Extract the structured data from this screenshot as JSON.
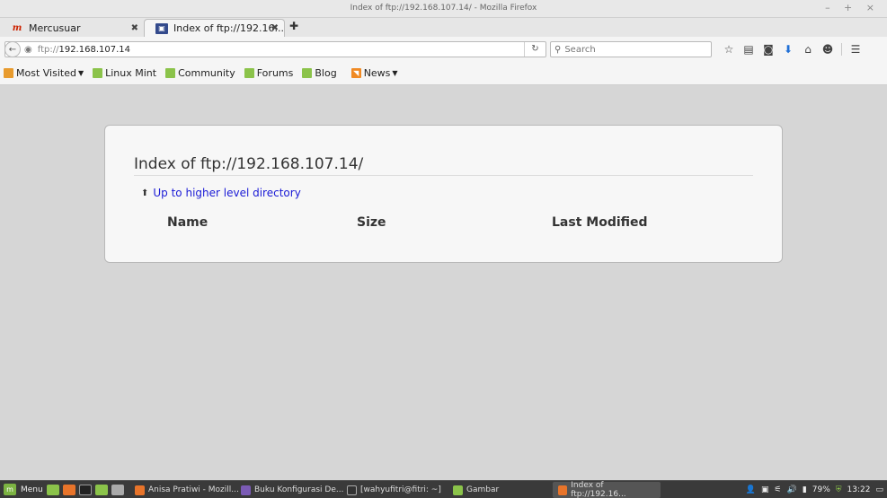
{
  "window": {
    "title": "Index of ftp://192.168.107.14/ - Mozilla Firefox",
    "controls": "– + ×"
  },
  "tabs": [
    {
      "label": "Mercusuar",
      "icon": "mercusuar-favicon",
      "active": false
    },
    {
      "label": "Index of ftp://192.16...",
      "icon": "ftp-favicon",
      "active": true
    }
  ],
  "navbar": {
    "url_proto": "ftp://",
    "url_host": "192.168.107.14",
    "search_placeholder": "Search"
  },
  "bookmarks": [
    {
      "label": "Most Visited",
      "icon": "folder-icon",
      "dropdown": true
    },
    {
      "label": "Linux Mint",
      "icon": "mint-icon"
    },
    {
      "label": "Community",
      "icon": "mint-icon"
    },
    {
      "label": "Forums",
      "icon": "mint-icon"
    },
    {
      "label": "Blog",
      "icon": "mint-icon"
    },
    {
      "label": "News",
      "icon": "rss-icon",
      "dropdown": true
    }
  ],
  "page": {
    "heading": "Index of ftp://192.168.107.14/",
    "up_link": "Up to higher level directory",
    "columns": [
      "Name",
      "Size",
      "Last Modified"
    ]
  },
  "taskbar": {
    "menu_label": "Menu",
    "windows": [
      {
        "label": "Anisa Pratiwi - Mozill...",
        "color": "#e8742a"
      },
      {
        "label": "Buku Konfigurasi De...",
        "color": "#7b5bb5"
      },
      {
        "label": "[wahyufitri@fitri: ~]",
        "color": "#333333"
      },
      {
        "label": "Gambar",
        "color": "#8bc34a"
      },
      {
        "label": "Index of ftp://192.16...",
        "color": "#e8742a",
        "active": true
      }
    ],
    "battery": "79%",
    "clock": "13:22"
  },
  "colors": {
    "link": "#1a1ad6",
    "background": "#d6d6d6",
    "panel": "#f7f7f7"
  }
}
